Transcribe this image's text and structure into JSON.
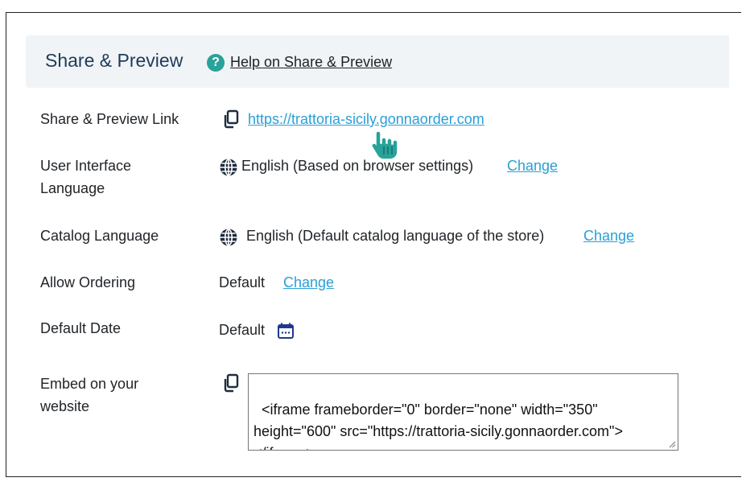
{
  "section": {
    "title": "Share & Preview",
    "help_link": "Help on Share & Preview"
  },
  "rows": {
    "share_link": {
      "label": "Share & Preview Link",
      "url": "https://trattoria-sicily.gonnaorder.com"
    },
    "ui_language": {
      "label_line1": "User Interface",
      "label_line2": "Language",
      "value": "English (Based on browser settings)",
      "change": "Change"
    },
    "catalog_language": {
      "label": "Catalog Language",
      "value": "English (Default catalog language of the store)",
      "change": "Change"
    },
    "allow_ordering": {
      "label": "Allow Ordering",
      "value": "Default",
      "change": "Change"
    },
    "default_date": {
      "label": "Default Date",
      "value": "Default"
    },
    "embed": {
      "label_line1": "Embed on your",
      "label_line2": "website",
      "code": "<iframe frameborder=\"0\" border=\"none\" width=\"350\"\nheight=\"600\" src=\"https://trattoria-sicily.gonnaorder.com\">\n</iframe>"
    }
  },
  "icons": {
    "help": "question-circle-icon",
    "copy": "copy-icon",
    "globe": "globe-icon",
    "calendar": "calendar-icon",
    "cursor": "hand-pointer-cursor"
  },
  "colors": {
    "header_bg": "#f0f4f6",
    "title": "#1f3a5c",
    "help_icon": "#27a39a",
    "link": "#2a9fd6",
    "cursor": "#27a39a"
  }
}
